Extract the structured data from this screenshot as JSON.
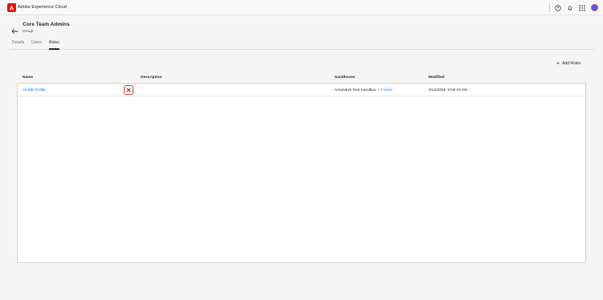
{
  "app": {
    "title": "Adobe Experience Cloud"
  },
  "colors": {
    "brand": "#eb1000",
    "link": "#1473e6",
    "highlight": "#d7373f"
  },
  "header": {
    "title": "Core Team Admins",
    "subtitle": "Group"
  },
  "tabs": [
    {
      "label": "Details",
      "active": false
    },
    {
      "label": "Users",
      "active": false
    },
    {
      "label": "Roles",
      "active": true
    }
  ],
  "actions": {
    "add_roles": "Add Roles"
  },
  "table": {
    "columns": [
      "Name",
      "Description",
      "Sandboxes",
      "Modified"
    ],
    "rows": [
      {
        "name": "ACME Profile",
        "description": "",
        "sandbox": "Amanda's Test Sandbox",
        "sandbox_more": "+ 7 more",
        "modified": "3/12/2025, 9:06:43 AM"
      }
    ]
  },
  "icons": {
    "logo": "adobe-logo-icon",
    "help": "help-icon",
    "notifications": "bell-icon",
    "apps": "apps-grid-icon",
    "back": "arrow-left-icon",
    "add": "plus-icon",
    "remove": "close-icon"
  }
}
